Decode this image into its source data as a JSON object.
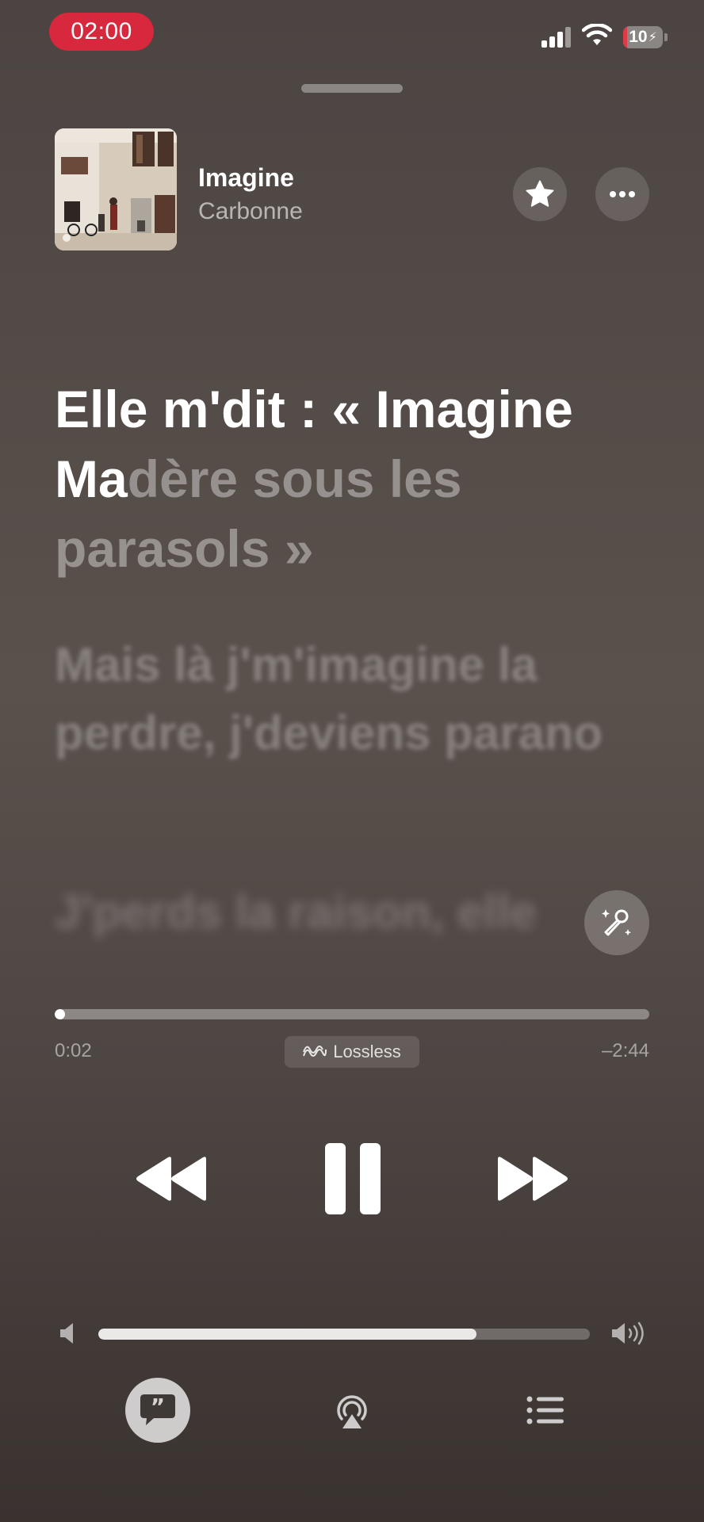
{
  "status_bar": {
    "time": "02:00",
    "battery_level": "10",
    "battery_fraction": 0.1,
    "colors": {
      "time_pill": "#d8283d",
      "battery_low": "#e03a45"
    }
  },
  "now_playing": {
    "title": "Imagine",
    "artist": "Carbonne"
  },
  "lyrics": {
    "current_sung": "Elle m'dit : « Imagine Ma",
    "current_unsung": "dère sous les parasols »",
    "next": "Mais là j'm'imagine la perdre, j'deviens parano",
    "after": "J'perds la raison, elle"
  },
  "playback": {
    "elapsed": "0:02",
    "remaining": "–2:44",
    "progress_fraction": 0.012,
    "quality_label": "Lossless",
    "state": "playing"
  },
  "volume": {
    "level_fraction": 0.77
  },
  "icons": {
    "star": "star-icon",
    "more": "ellipsis-icon",
    "sing": "microphone-sparkle-icon",
    "lossless": "lossless-wave-icon",
    "rewind": "rewind-icon",
    "pause": "pause-icon",
    "forward": "fast-forward-icon",
    "volume_low": "speaker-low-icon",
    "volume_high": "speaker-high-icon",
    "lyrics": "lyrics-quote-bubble-icon",
    "airplay": "airplay-icon",
    "queue": "list-icon"
  }
}
